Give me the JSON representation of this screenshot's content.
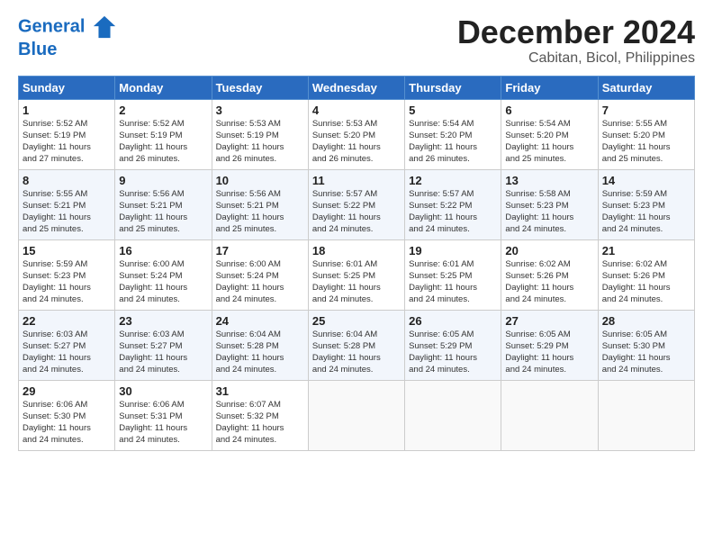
{
  "logo": {
    "line1": "General",
    "line2": "Blue"
  },
  "header": {
    "month": "December 2024",
    "location": "Cabitan, Bicol, Philippines"
  },
  "weekdays": [
    "Sunday",
    "Monday",
    "Tuesday",
    "Wednesday",
    "Thursday",
    "Friday",
    "Saturday"
  ],
  "weeks": [
    [
      {
        "day": "1",
        "lines": [
          "Sunrise: 5:52 AM",
          "Sunset: 5:19 PM",
          "Daylight: 11 hours",
          "and 27 minutes."
        ]
      },
      {
        "day": "2",
        "lines": [
          "Sunrise: 5:52 AM",
          "Sunset: 5:19 PM",
          "Daylight: 11 hours",
          "and 26 minutes."
        ]
      },
      {
        "day": "3",
        "lines": [
          "Sunrise: 5:53 AM",
          "Sunset: 5:19 PM",
          "Daylight: 11 hours",
          "and 26 minutes."
        ]
      },
      {
        "day": "4",
        "lines": [
          "Sunrise: 5:53 AM",
          "Sunset: 5:20 PM",
          "Daylight: 11 hours",
          "and 26 minutes."
        ]
      },
      {
        "day": "5",
        "lines": [
          "Sunrise: 5:54 AM",
          "Sunset: 5:20 PM",
          "Daylight: 11 hours",
          "and 26 minutes."
        ]
      },
      {
        "day": "6",
        "lines": [
          "Sunrise: 5:54 AM",
          "Sunset: 5:20 PM",
          "Daylight: 11 hours",
          "and 25 minutes."
        ]
      },
      {
        "day": "7",
        "lines": [
          "Sunrise: 5:55 AM",
          "Sunset: 5:20 PM",
          "Daylight: 11 hours",
          "and 25 minutes."
        ]
      }
    ],
    [
      {
        "day": "8",
        "lines": [
          "Sunrise: 5:55 AM",
          "Sunset: 5:21 PM",
          "Daylight: 11 hours",
          "and 25 minutes."
        ]
      },
      {
        "day": "9",
        "lines": [
          "Sunrise: 5:56 AM",
          "Sunset: 5:21 PM",
          "Daylight: 11 hours",
          "and 25 minutes."
        ]
      },
      {
        "day": "10",
        "lines": [
          "Sunrise: 5:56 AM",
          "Sunset: 5:21 PM",
          "Daylight: 11 hours",
          "and 25 minutes."
        ]
      },
      {
        "day": "11",
        "lines": [
          "Sunrise: 5:57 AM",
          "Sunset: 5:22 PM",
          "Daylight: 11 hours",
          "and 24 minutes."
        ]
      },
      {
        "day": "12",
        "lines": [
          "Sunrise: 5:57 AM",
          "Sunset: 5:22 PM",
          "Daylight: 11 hours",
          "and 24 minutes."
        ]
      },
      {
        "day": "13",
        "lines": [
          "Sunrise: 5:58 AM",
          "Sunset: 5:23 PM",
          "Daylight: 11 hours",
          "and 24 minutes."
        ]
      },
      {
        "day": "14",
        "lines": [
          "Sunrise: 5:59 AM",
          "Sunset: 5:23 PM",
          "Daylight: 11 hours",
          "and 24 minutes."
        ]
      }
    ],
    [
      {
        "day": "15",
        "lines": [
          "Sunrise: 5:59 AM",
          "Sunset: 5:23 PM",
          "Daylight: 11 hours",
          "and 24 minutes."
        ]
      },
      {
        "day": "16",
        "lines": [
          "Sunrise: 6:00 AM",
          "Sunset: 5:24 PM",
          "Daylight: 11 hours",
          "and 24 minutes."
        ]
      },
      {
        "day": "17",
        "lines": [
          "Sunrise: 6:00 AM",
          "Sunset: 5:24 PM",
          "Daylight: 11 hours",
          "and 24 minutes."
        ]
      },
      {
        "day": "18",
        "lines": [
          "Sunrise: 6:01 AM",
          "Sunset: 5:25 PM",
          "Daylight: 11 hours",
          "and 24 minutes."
        ]
      },
      {
        "day": "19",
        "lines": [
          "Sunrise: 6:01 AM",
          "Sunset: 5:25 PM",
          "Daylight: 11 hours",
          "and 24 minutes."
        ]
      },
      {
        "day": "20",
        "lines": [
          "Sunrise: 6:02 AM",
          "Sunset: 5:26 PM",
          "Daylight: 11 hours",
          "and 24 minutes."
        ]
      },
      {
        "day": "21",
        "lines": [
          "Sunrise: 6:02 AM",
          "Sunset: 5:26 PM",
          "Daylight: 11 hours",
          "and 24 minutes."
        ]
      }
    ],
    [
      {
        "day": "22",
        "lines": [
          "Sunrise: 6:03 AM",
          "Sunset: 5:27 PM",
          "Daylight: 11 hours",
          "and 24 minutes."
        ]
      },
      {
        "day": "23",
        "lines": [
          "Sunrise: 6:03 AM",
          "Sunset: 5:27 PM",
          "Daylight: 11 hours",
          "and 24 minutes."
        ]
      },
      {
        "day": "24",
        "lines": [
          "Sunrise: 6:04 AM",
          "Sunset: 5:28 PM",
          "Daylight: 11 hours",
          "and 24 minutes."
        ]
      },
      {
        "day": "25",
        "lines": [
          "Sunrise: 6:04 AM",
          "Sunset: 5:28 PM",
          "Daylight: 11 hours",
          "and 24 minutes."
        ]
      },
      {
        "day": "26",
        "lines": [
          "Sunrise: 6:05 AM",
          "Sunset: 5:29 PM",
          "Daylight: 11 hours",
          "and 24 minutes."
        ]
      },
      {
        "day": "27",
        "lines": [
          "Sunrise: 6:05 AM",
          "Sunset: 5:29 PM",
          "Daylight: 11 hours",
          "and 24 minutes."
        ]
      },
      {
        "day": "28",
        "lines": [
          "Sunrise: 6:05 AM",
          "Sunset: 5:30 PM",
          "Daylight: 11 hours",
          "and 24 minutes."
        ]
      }
    ],
    [
      {
        "day": "29",
        "lines": [
          "Sunrise: 6:06 AM",
          "Sunset: 5:30 PM",
          "Daylight: 11 hours",
          "and 24 minutes."
        ]
      },
      {
        "day": "30",
        "lines": [
          "Sunrise: 6:06 AM",
          "Sunset: 5:31 PM",
          "Daylight: 11 hours",
          "and 24 minutes."
        ]
      },
      {
        "day": "31",
        "lines": [
          "Sunrise: 6:07 AM",
          "Sunset: 5:32 PM",
          "Daylight: 11 hours",
          "and 24 minutes."
        ]
      },
      {
        "day": "",
        "lines": []
      },
      {
        "day": "",
        "lines": []
      },
      {
        "day": "",
        "lines": []
      },
      {
        "day": "",
        "lines": []
      }
    ]
  ]
}
